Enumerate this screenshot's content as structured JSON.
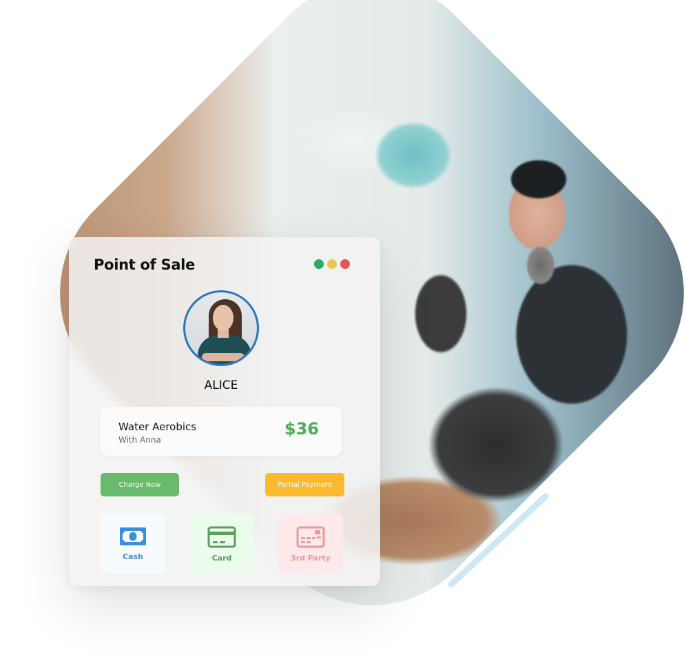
{
  "card": {
    "title": "Point of Sale",
    "window_controls": [
      {
        "name": "green",
        "color": "#27ae60"
      },
      {
        "name": "yellow",
        "color": "#ecc84a"
      },
      {
        "name": "red",
        "color": "#ea5455"
      }
    ],
    "customer": {
      "name": "ALICE",
      "avatar_icon": "customer-avatar"
    },
    "service": {
      "name": "Water Aerobics",
      "instructor": "With Anna",
      "price": "$36"
    },
    "actions": {
      "charge_label": "Charge Now",
      "partial_label": "Partial Payment"
    },
    "payment_methods": [
      {
        "label": "Cash",
        "icon": "cash-icon",
        "color": "#3a8ee0"
      },
      {
        "label": "Card",
        "icon": "credit-card-icon",
        "color": "#5a9e5c"
      },
      {
        "label": "3rd Party",
        "icon": "third-party-card-icon",
        "color": "#e79a9c"
      }
    ]
  },
  "colors": {
    "accent_blue": "#1e9ae0",
    "price_green": "#4cae55",
    "charge_green": "#6aba6b",
    "partial_orange": "#fbb92e",
    "avatar_ring": "#2a75c0"
  },
  "background": {
    "photo": "man-at-gym-front-desk-photo"
  }
}
